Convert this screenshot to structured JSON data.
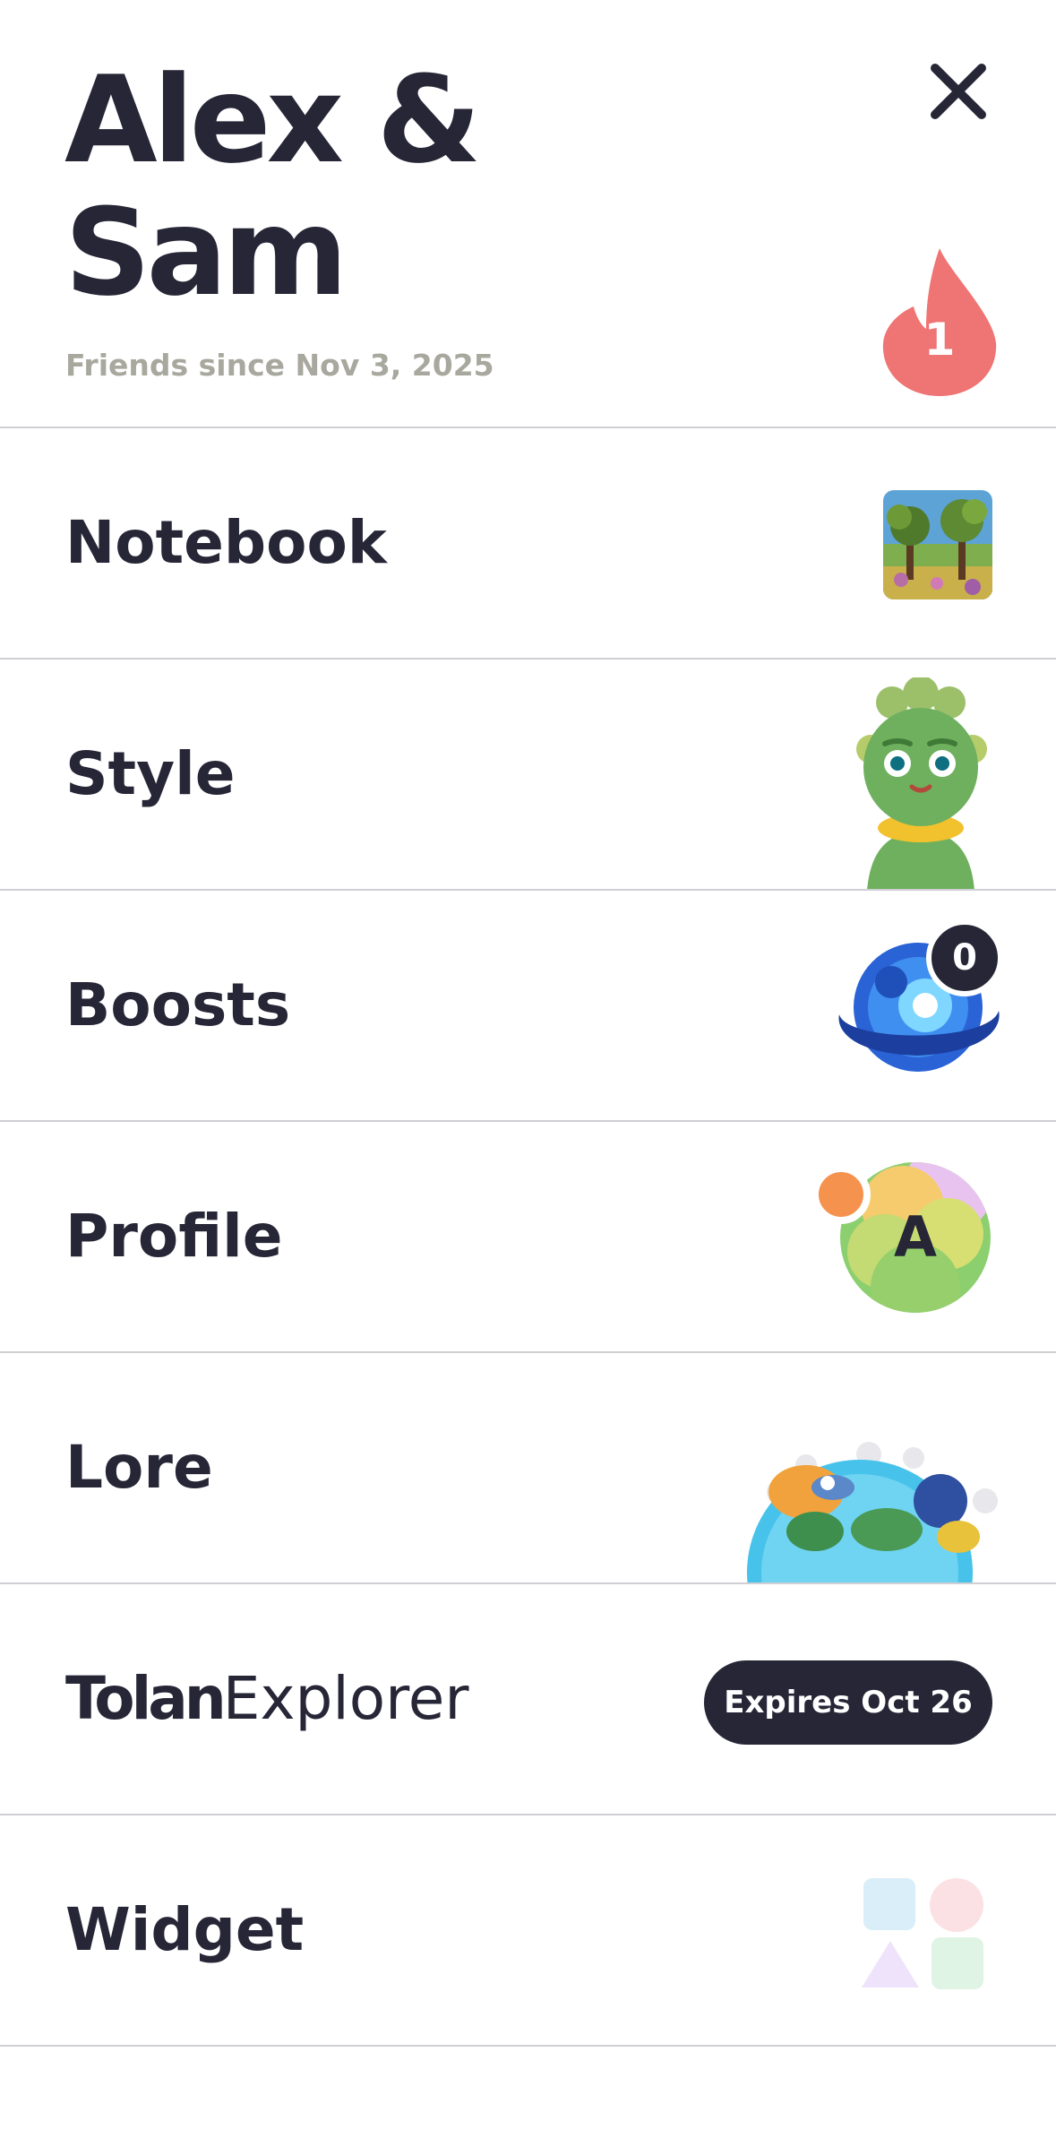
{
  "header": {
    "title_line1": "Alex &",
    "title_line2": "Sam",
    "subtitle": "Friends since Nov 3, 2025",
    "close_icon": "close-icon",
    "streak": {
      "icon": "flame-icon",
      "count": "1",
      "color": "#ef7474"
    }
  },
  "menu": {
    "notebook": {
      "label": "Notebook",
      "icon": "landscape-thumbnail"
    },
    "style": {
      "label": "Style",
      "icon": "character-avatar"
    },
    "boosts": {
      "label": "Boosts",
      "icon": "orb-icon",
      "count": "0"
    },
    "profile": {
      "label": "Profile",
      "icon": "profile-avatar",
      "initial": "A"
    },
    "lore": {
      "label": "Lore",
      "icon": "planet-icon"
    },
    "explorer": {
      "brand": "Tolan",
      "label": "Explorer",
      "badge": "Expires Oct 26"
    },
    "widget": {
      "label": "Widget",
      "icon": "widget-shapes-icon"
    }
  },
  "colors": {
    "text": "#262637",
    "muted": "#a8a89e",
    "divider": "#cfcfd4",
    "accent_flame": "#ef7474",
    "badge_dark": "#262637"
  }
}
